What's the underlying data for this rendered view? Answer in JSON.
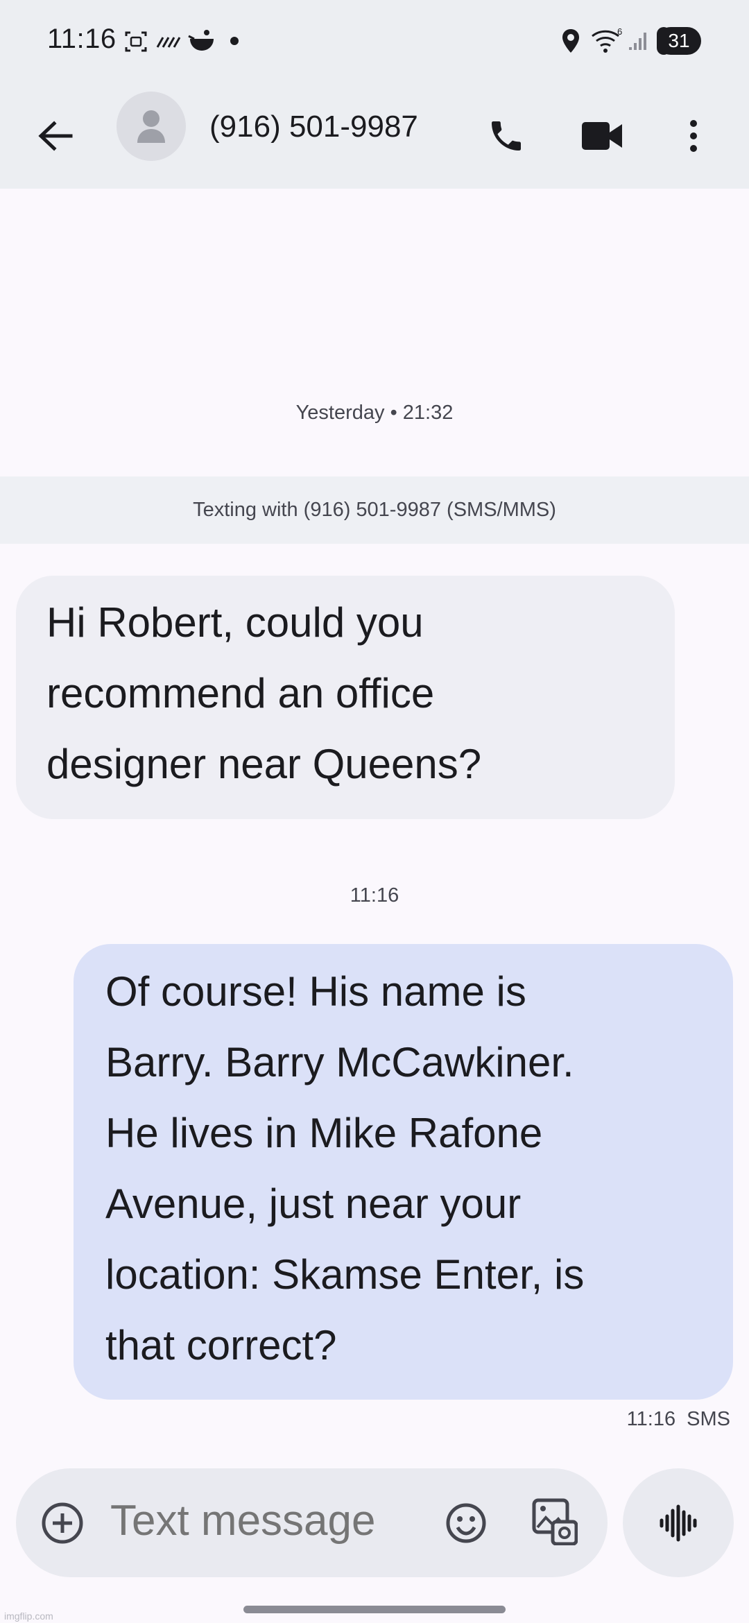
{
  "status_bar": {
    "time": "11:16",
    "battery": "31",
    "icons": [
      "screenshot-icon",
      "stripes-icon",
      "teapot-icon",
      "dot-icon",
      "location-icon",
      "wifi-icon",
      "signal-icon",
      "battery-icon"
    ]
  },
  "app_bar": {
    "contact": "(916) 501-9987",
    "icons": [
      "back-arrow-icon",
      "person-icon",
      "phone-icon",
      "video-camera-icon",
      "more-vert-icon"
    ]
  },
  "conversation": {
    "first_timestamp": "Yesterday • 21:32",
    "banner": "Texting with (916) 501-9987 (SMS/MMS)",
    "messages": [
      {
        "direction": "incoming",
        "lines": [
          "Hi Robert, could you",
          "recommend an office",
          "designer near Queens?"
        ]
      },
      {
        "direction": "outgoing",
        "timestamp": "11:16",
        "lines": [
          "Of course! His name is",
          "Barry. Barry McCawkiner.",
          "He lives in Mike Rafone",
          "Avenue, just near your",
          "location: Skamse Enter, is",
          "that correct?"
        ],
        "meta": "11:16 SMS"
      }
    ]
  },
  "composer": {
    "placeholder": "Text message",
    "icons": [
      "add-circle-icon",
      "emoji-icon",
      "gallery-icon",
      "voice-waveform-icon"
    ]
  },
  "watermark": "imgflip.com",
  "colors": {
    "background": "#fbf8fd",
    "header": "#eceef2",
    "incoming_bubble": "#eeeef4",
    "outgoing_bubble": "#dbe1f8",
    "banner": "#eef0f4"
  }
}
